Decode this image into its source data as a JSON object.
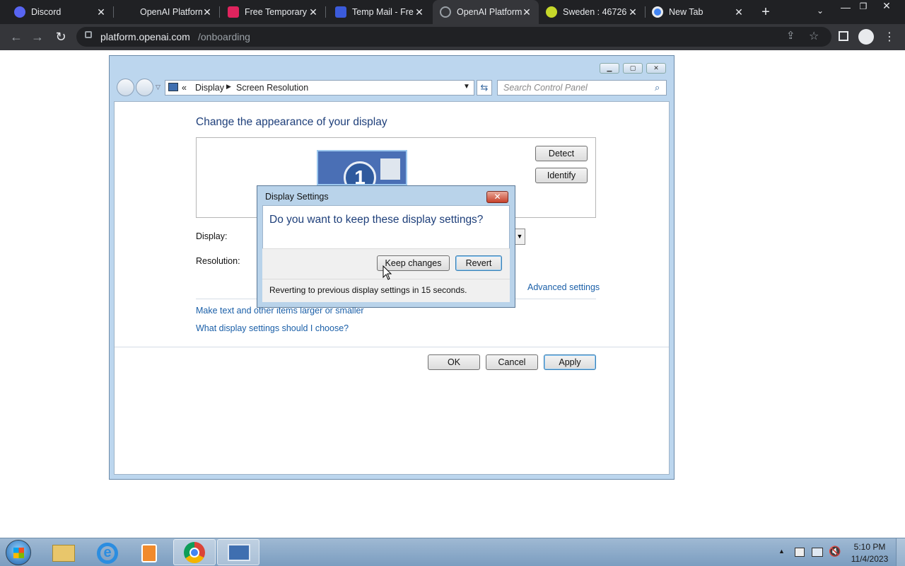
{
  "browser": {
    "tabs": [
      {
        "title": "Discord",
        "color": "#5865f2"
      },
      {
        "title": "OpenAI Platform",
        "color": "#202124"
      },
      {
        "title": "Free Temporary",
        "color": "#e0245e"
      },
      {
        "title": "Temp Mail - Fre",
        "color": "#3b5bdb"
      },
      {
        "title": "OpenAI Platform",
        "color": "#202124"
      },
      {
        "title": "Sweden : 46726",
        "color": "#c6d82a"
      },
      {
        "title": "New Tab",
        "color": "#4285f4"
      }
    ],
    "url_host": "platform.openai.com",
    "url_path": "/onboarding",
    "new_tab_symbol": "+",
    "close_symbol": "✕"
  },
  "window": {
    "breadcrumb": {
      "root_symbol": "«",
      "item1": "Display",
      "item2": "Screen Resolution"
    },
    "search_placeholder": "Search Control Panel",
    "heading": "Change the appearance of your display",
    "monitor_number": "1",
    "detect_label": "Detect",
    "identify_label": "Identify",
    "display_label": "Display:",
    "resolution_label": "Resolution:",
    "advanced_link": "Advanced settings",
    "link_text_size": "Make text and other items larger or smaller",
    "link_which_settings": "What display settings should I choose?",
    "ok_label": "OK",
    "cancel_label": "Cancel",
    "apply_label": "Apply"
  },
  "dialog": {
    "title": "Display Settings",
    "question": "Do you want to keep these display settings?",
    "keep_label": "Keep changes",
    "revert_label": "Revert",
    "countdown_text": "Reverting to previous display settings in 15 seconds.",
    "close_symbol": "✕"
  },
  "taskbar": {
    "time": "5:10 PM",
    "date": "11/4/2023"
  }
}
